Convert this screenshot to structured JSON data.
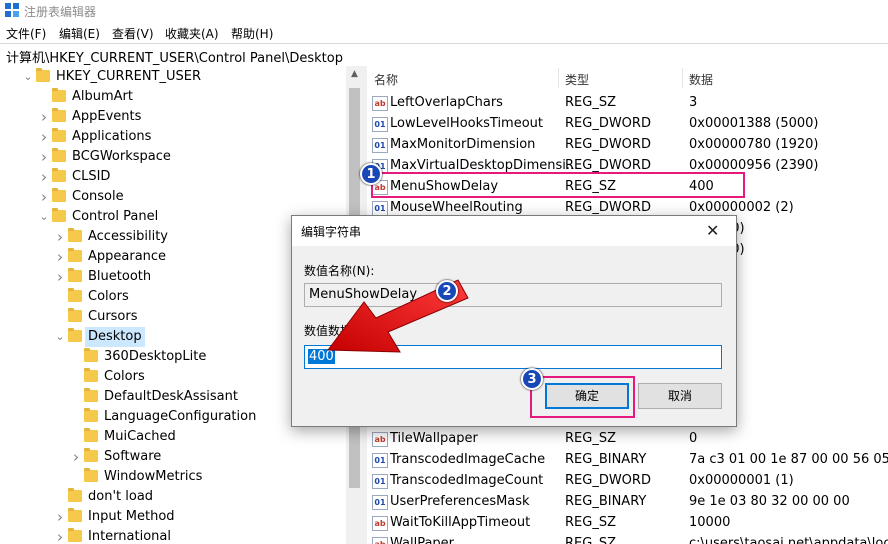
{
  "window": {
    "title": "注册表编辑器"
  },
  "menu": [
    "文件(F)",
    "编辑(E)",
    "查看(V)",
    "收藏夹(A)",
    "帮助(H)"
  ],
  "address": "计算机\\HKEY_CURRENT_USER\\Control Panel\\Desktop",
  "tree": [
    {
      "label": "HKEY_CURRENT_USER",
      "level": 0,
      "arrow": "v"
    },
    {
      "label": "AlbumArt",
      "level": 1,
      "arrow": ""
    },
    {
      "label": "AppEvents",
      "level": 1,
      "arrow": ">"
    },
    {
      "label": "Applications",
      "level": 1,
      "arrow": ">"
    },
    {
      "label": "BCGWorkspace",
      "level": 1,
      "arrow": ">"
    },
    {
      "label": "CLSID",
      "level": 1,
      "arrow": ">"
    },
    {
      "label": "Console",
      "level": 1,
      "arrow": ">"
    },
    {
      "label": "Control Panel",
      "level": 1,
      "arrow": "v"
    },
    {
      "label": "Accessibility",
      "level": 2,
      "arrow": ">"
    },
    {
      "label": "Appearance",
      "level": 2,
      "arrow": ">"
    },
    {
      "label": "Bluetooth",
      "level": 2,
      "arrow": ">"
    },
    {
      "label": "Colors",
      "level": 2,
      "arrow": ""
    },
    {
      "label": "Cursors",
      "level": 2,
      "arrow": ""
    },
    {
      "label": "Desktop",
      "level": 2,
      "arrow": "v",
      "selected": true
    },
    {
      "label": "360DesktopLite",
      "level": 3,
      "arrow": ""
    },
    {
      "label": "Colors",
      "level": 3,
      "arrow": ""
    },
    {
      "label": "DefaultDeskAssisant",
      "level": 3,
      "arrow": ""
    },
    {
      "label": "LanguageConfiguration",
      "level": 3,
      "arrow": ""
    },
    {
      "label": "MuiCached",
      "level": 3,
      "arrow": ""
    },
    {
      "label": "Software",
      "level": 3,
      "arrow": ">"
    },
    {
      "label": "WindowMetrics",
      "level": 3,
      "arrow": ""
    },
    {
      "label": "don't load",
      "level": 2,
      "arrow": ""
    },
    {
      "label": "Input Method",
      "level": 2,
      "arrow": ">"
    },
    {
      "label": "International",
      "level": 2,
      "arrow": ">"
    }
  ],
  "columns": {
    "name": "名称",
    "type": "类型",
    "data": "数据"
  },
  "values": [
    {
      "name": "LeftOverlapChars",
      "type": "REG_SZ",
      "data": "3",
      "icon": "sz"
    },
    {
      "name": "LowLevelHooksTimeout",
      "type": "REG_DWORD",
      "data": "0x00001388 (5000)",
      "icon": "bin"
    },
    {
      "name": "MaxMonitorDimension",
      "type": "REG_DWORD",
      "data": "0x00000780 (1920)",
      "icon": "bin"
    },
    {
      "name": "MaxVirtualDesktopDimensi...",
      "type": "REG_DWORD",
      "data": "0x00000956 (2390)",
      "icon": "bin"
    },
    {
      "name": "MenuShowDelay",
      "type": "REG_SZ",
      "data": "400",
      "icon": "sz"
    },
    {
      "name": "MouseWheelRouting",
      "type": "REG_DWORD",
      "data": "0x00000002 (2)",
      "icon": "bin"
    },
    {
      "name": "",
      "type": "",
      "data": "0000 (0)",
      "icon": ""
    },
    {
      "name": "",
      "type": "",
      "data": "0000 (0)",
      "icon": ""
    },
    {
      "name": "",
      "type": "",
      "data": "",
      "icon": ""
    },
    {
      "name": "",
      "type": "",
      "data": "",
      "icon": ""
    },
    {
      "name": "",
      "type": "",
      "data": "s-CN",
      "icon": ""
    },
    {
      "name": "",
      "type": "",
      "data": "",
      "icon": ""
    },
    {
      "name": "",
      "type": "",
      "data": "",
      "icon": ""
    },
    {
      "name": "",
      "type": "",
      "data": "",
      "icon": ""
    },
    {
      "name": "",
      "type": "",
      "data": "",
      "icon": ""
    },
    {
      "name": "",
      "type": "",
      "data": "",
      "icon": ""
    },
    {
      "name": "TileWallpaper",
      "type": "REG_SZ",
      "data": "0",
      "icon": "sz"
    },
    {
      "name": "TranscodedImageCache",
      "type": "REG_BINARY",
      "data": "7a c3 01 00 1e 87 00 00 56 05 00 0",
      "icon": "bin"
    },
    {
      "name": "TranscodedImageCount",
      "type": "REG_DWORD",
      "data": "0x00000001 (1)",
      "icon": "bin"
    },
    {
      "name": "UserPreferencesMask",
      "type": "REG_BINARY",
      "data": "9e 1e 03 80 32 00 00 00",
      "icon": "bin"
    },
    {
      "name": "WaitToKillAppTimeout",
      "type": "REG_SZ",
      "data": "10000",
      "icon": "sz"
    },
    {
      "name": "WallPaper",
      "type": "REG_SZ",
      "data": "c:\\users\\taosai.net\\appdata\\local\\",
      "icon": "sz"
    }
  ],
  "dialog": {
    "title": "编辑字符串",
    "close": "✕",
    "name_label": "数值名称(N):",
    "name_value": "MenuShowDelay",
    "data_label": "数值数据(V):",
    "data_value": "400",
    "ok": "确定",
    "cancel": "取消"
  },
  "annotations": {
    "step1": "1",
    "step2": "2",
    "step3": "3",
    "color": "#e6197f",
    "badge_color": "#1848b8"
  }
}
